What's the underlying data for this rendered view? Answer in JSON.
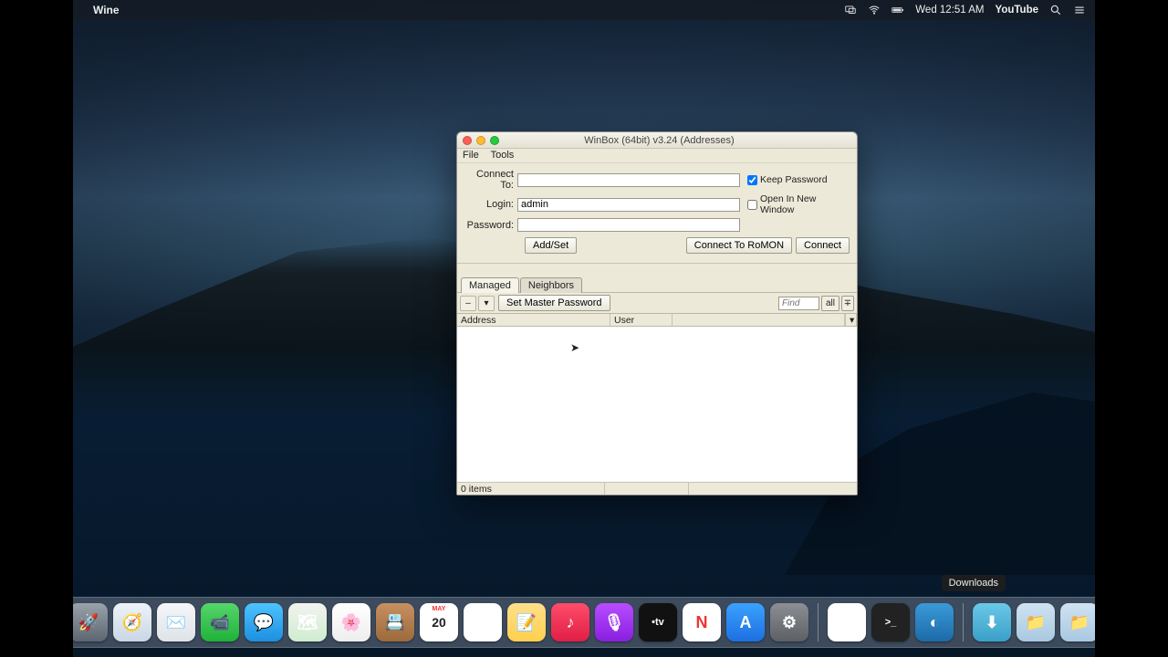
{
  "menubar": {
    "app": "Wine",
    "clock": "Wed 12:51 AM",
    "youtube": "YouTube"
  },
  "dock_tooltip": "Downloads",
  "window": {
    "title": "WinBox (64bit) v3.24 (Addresses)",
    "menu": {
      "file": "File",
      "tools": "Tools"
    },
    "labels": {
      "connect_to": "Connect To:",
      "login": "Login:",
      "password": "Password:",
      "keep_password": "Keep Password",
      "open_new_window": "Open In New Window"
    },
    "values": {
      "connect_to": "",
      "login": "admin",
      "password": "",
      "keep_password_checked": true,
      "open_new_window_checked": false
    },
    "buttons": {
      "addset": "Add/Set",
      "connect_romon": "Connect To RoMON",
      "connect": "Connect",
      "set_master_password": "Set Master Password"
    },
    "tabs": {
      "managed": "Managed",
      "neighbors": "Neighbors"
    },
    "find_placeholder": "Find",
    "filter_all": "all",
    "columns": {
      "address": "Address",
      "user": "User"
    },
    "status": "0 items"
  },
  "dock": [
    {
      "name": "finder",
      "bg": "linear-gradient(#4aa6ee,#1e6fc6)",
      "glyph": "😀"
    },
    {
      "name": "launchpad",
      "bg": "linear-gradient(#9aa3ab,#5c6670)",
      "glyph": "🚀"
    },
    {
      "name": "safari",
      "bg": "linear-gradient(#eef3f8,#c9d6e4)",
      "glyph": "🧭"
    },
    {
      "name": "mail",
      "bg": "linear-gradient(#f5f6f8,#dfe3e8)",
      "glyph": "✉️"
    },
    {
      "name": "facetime",
      "bg": "linear-gradient(#55d66a,#1fb23a)",
      "glyph": "📹"
    },
    {
      "name": "messages",
      "bg": "linear-gradient(#4dc3ff,#1d8fe0)",
      "glyph": "💬"
    },
    {
      "name": "maps",
      "bg": "linear-gradient(#f2f4f0,#cfeccf)",
      "glyph": "🗺"
    },
    {
      "name": "photos",
      "bg": "linear-gradient(#ffffff,#eeeeee)",
      "glyph": "🌸"
    },
    {
      "name": "contacts",
      "bg": "linear-gradient(#c89060,#9c6a3c)",
      "glyph": "📇"
    },
    {
      "name": "calendar",
      "bg": "#ffffff",
      "glyph": "20"
    },
    {
      "name": "reminders",
      "bg": "#ffffff",
      "glyph": "☰"
    },
    {
      "name": "notes",
      "bg": "linear-gradient(#ffe08a,#ffcf4d)",
      "glyph": "📝"
    },
    {
      "name": "music",
      "bg": "linear-gradient(#ff4d6a,#e01e45)",
      "glyph": "♪"
    },
    {
      "name": "podcasts",
      "bg": "linear-gradient(#b84dff,#8a1ee0)",
      "glyph": "🎙"
    },
    {
      "name": "tv",
      "bg": "#111",
      "glyph": "tv"
    },
    {
      "name": "news",
      "bg": "#fff",
      "glyph": "N"
    },
    {
      "name": "appstore",
      "bg": "linear-gradient(#3aa2ff,#1d6fe0)",
      "glyph": "A"
    },
    {
      "name": "settings",
      "bg": "linear-gradient(#8c8f94,#5c5f64)",
      "glyph": "⚙"
    },
    {
      "name": "textedit",
      "bg": "#fff",
      "glyph": "✎"
    },
    {
      "name": "terminal",
      "bg": "#222",
      "glyph": ">_"
    },
    {
      "name": "bluestacks",
      "bg": "linear-gradient(#3a9ad8,#1d6aa8)",
      "glyph": "◐"
    },
    {
      "name": "downloads",
      "bg": "linear-gradient(#6ac8e8,#3aa0c8)",
      "glyph": "⬇"
    },
    {
      "name": "folder1",
      "bg": "linear-gradient(#cfe3f2,#a8c8e0)",
      "glyph": "📁"
    },
    {
      "name": "folder2",
      "bg": "linear-gradient(#cfe3f2,#a8c8e0)",
      "glyph": "📁"
    },
    {
      "name": "trash",
      "bg": "linear-gradient(#b8bcc2,#8c9096)",
      "glyph": "🗑"
    }
  ]
}
